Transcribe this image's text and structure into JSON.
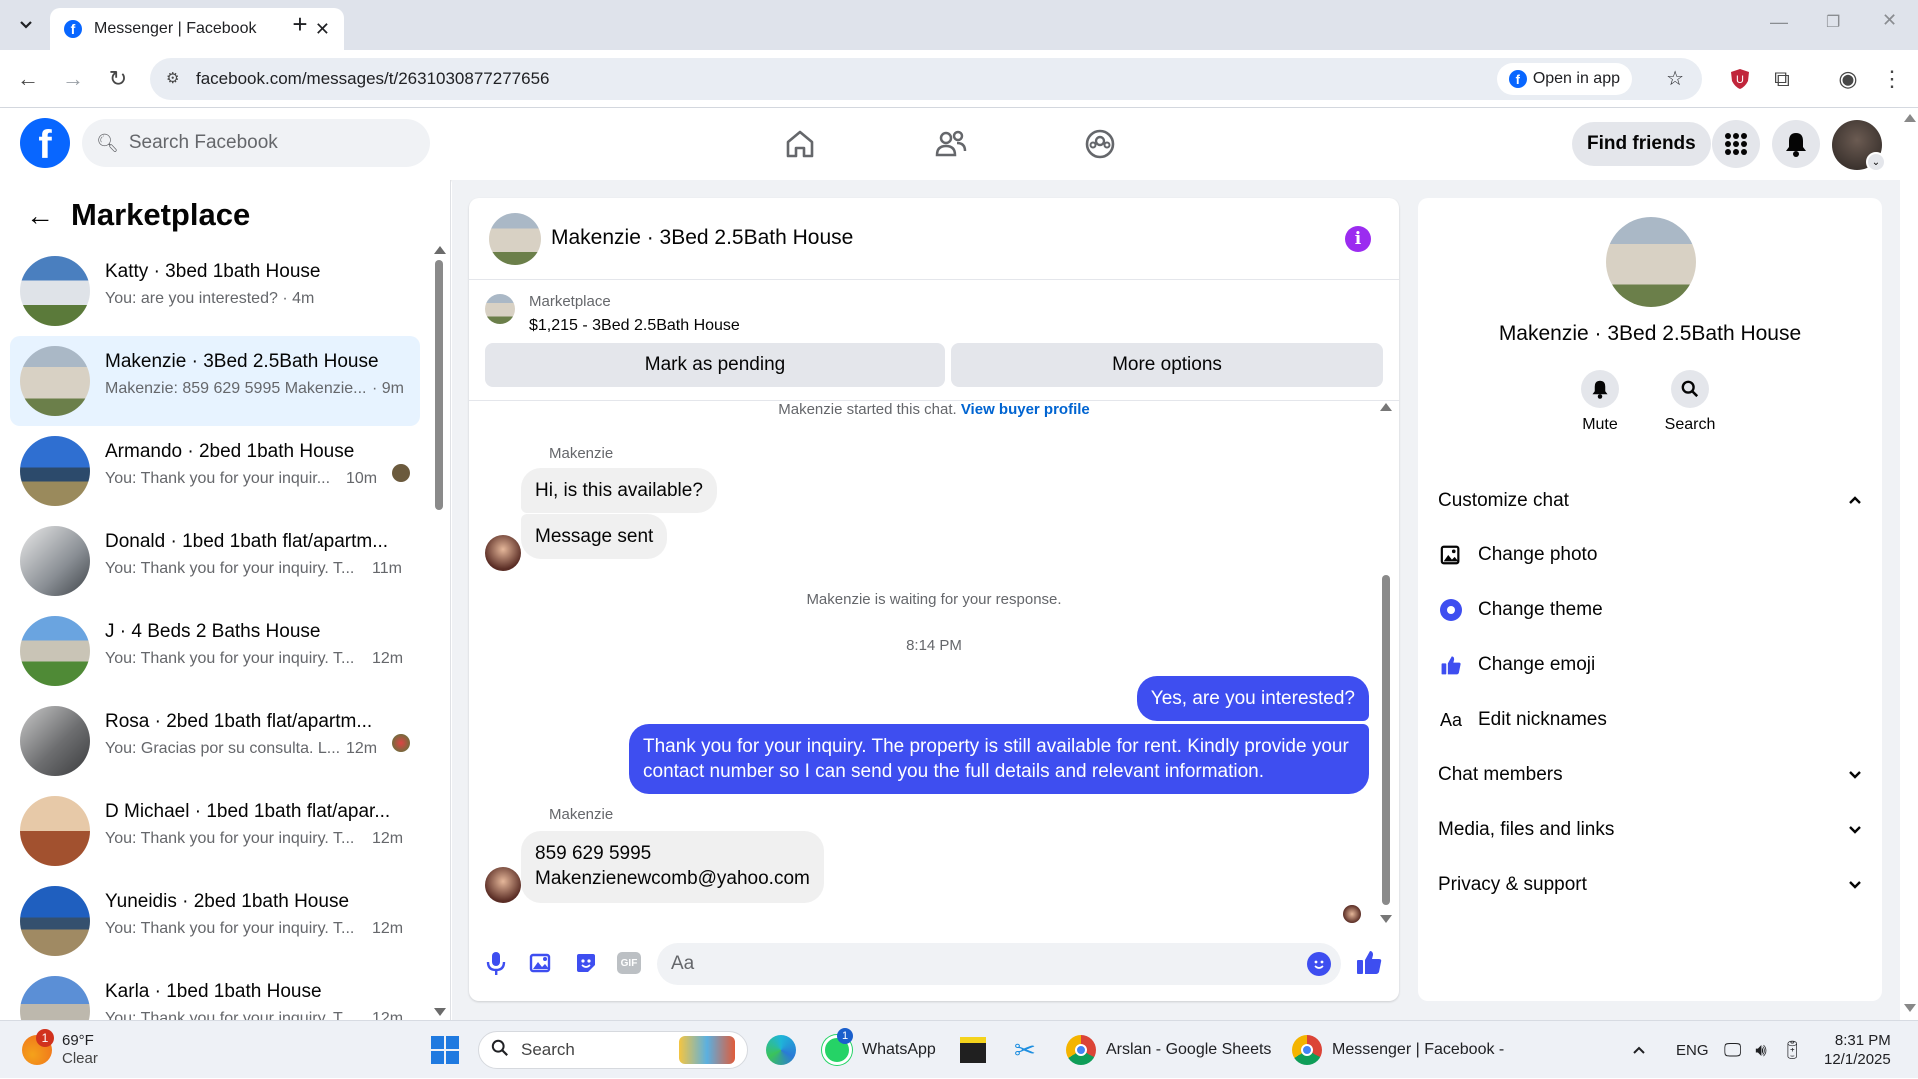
{
  "browser": {
    "tab_title": "Messenger | Facebook",
    "url": "facebook.com/messages/t/2631030877277656",
    "open_in_app": "Open in app"
  },
  "fbheader": {
    "search_placeholder": "Search Facebook",
    "find_friends": "Find friends"
  },
  "sidebar": {
    "title": "Marketplace",
    "conversations": [
      {
        "name": "Katty · 3bed 1bath House",
        "preview": "You: are you interested? · 4m",
        "time": ""
      },
      {
        "name": "Makenzie · 3Bed 2.5Bath House",
        "preview": "Makenzie: 859 629 5995 Makenzie...",
        "time": "· 9m"
      },
      {
        "name": "Armando · 2bed 1bath House",
        "preview": "You: Thank you for your inquir...",
        "time": "10m"
      },
      {
        "name": "Donald · 1bed 1bath flat/apartm...",
        "preview": "You: Thank you for your inquiry. T...",
        "time": "11m"
      },
      {
        "name": "J · 4 Beds 2 Baths House",
        "preview": "You: Thank you for your inquiry. T...",
        "time": "12m"
      },
      {
        "name": "Rosa · 2bed 1bath flat/apartm...",
        "preview": "You: Gracias por su consulta. L...",
        "time": "12m"
      },
      {
        "name": "D Michael · 1bed 1bath flat/apar...",
        "preview": "You: Thank you for your inquiry. T...",
        "time": "12m"
      },
      {
        "name": "Yuneidis · 2bed 1bath House",
        "preview": "You: Thank you for your inquiry. T...",
        "time": "12m"
      },
      {
        "name": "Karla · 1bed 1bath House",
        "preview": "You: Thank you for your inquiry. T...",
        "time": "12m"
      }
    ]
  },
  "chat": {
    "title": "Makenzie · 3Bed 2.5Bath House",
    "listing_source": "Marketplace",
    "listing_title": "$1,215 - 3Bed 2.5Bath House",
    "mark_pending": "Mark as pending",
    "more_options": "More options",
    "started_note": "Makenzie started this chat.",
    "view_buyer": "View buyer profile",
    "sender1": "Makenzie",
    "msg1": "Hi, is this available?",
    "msg2": "Message sent",
    "waiting": "Makenzie is waiting for your response.",
    "timestamp": "8:14 PM",
    "out1": "Yes, are you interested?",
    "out2_line1": "Thank you for your inquiry. The property is still available for rent. Kindly provide your",
    "out2_line2": "contact number so I can send you the full details and relevant information.",
    "sender2": "Makenzie",
    "msg3_line1": "859 629 5995",
    "msg3_line2": "Makenzienewcomb@yahoo.com",
    "composer_placeholder": "Aa"
  },
  "details": {
    "title": "Makenzie · 3Bed 2.5Bath House",
    "mute": "Mute",
    "search": "Search",
    "customize": "Customize chat",
    "change_photo": "Change photo",
    "change_theme": "Change theme",
    "change_emoji": "Change emoji",
    "edit_nicknames": "Edit nicknames",
    "nick_icon": "Aa",
    "chat_members": "Chat members",
    "media": "Media, files and links",
    "privacy": "Privacy & support"
  },
  "taskbar": {
    "weather_temp": "69°F",
    "weather_desc": "Clear",
    "weather_badge": "1",
    "search": "Search",
    "whatsapp": "WhatsApp",
    "whatsapp_badge": "1",
    "sheets": "Arslan - Google Sheets",
    "messenger": "Messenger | Facebook -",
    "lang": "ENG",
    "time": "8:31 PM",
    "date": "12/1/2025"
  },
  "colors": {
    "fb_blue": "#0866ff",
    "messenger_accent": "#3e4ef0",
    "purple_info": "#9b2cf0"
  }
}
